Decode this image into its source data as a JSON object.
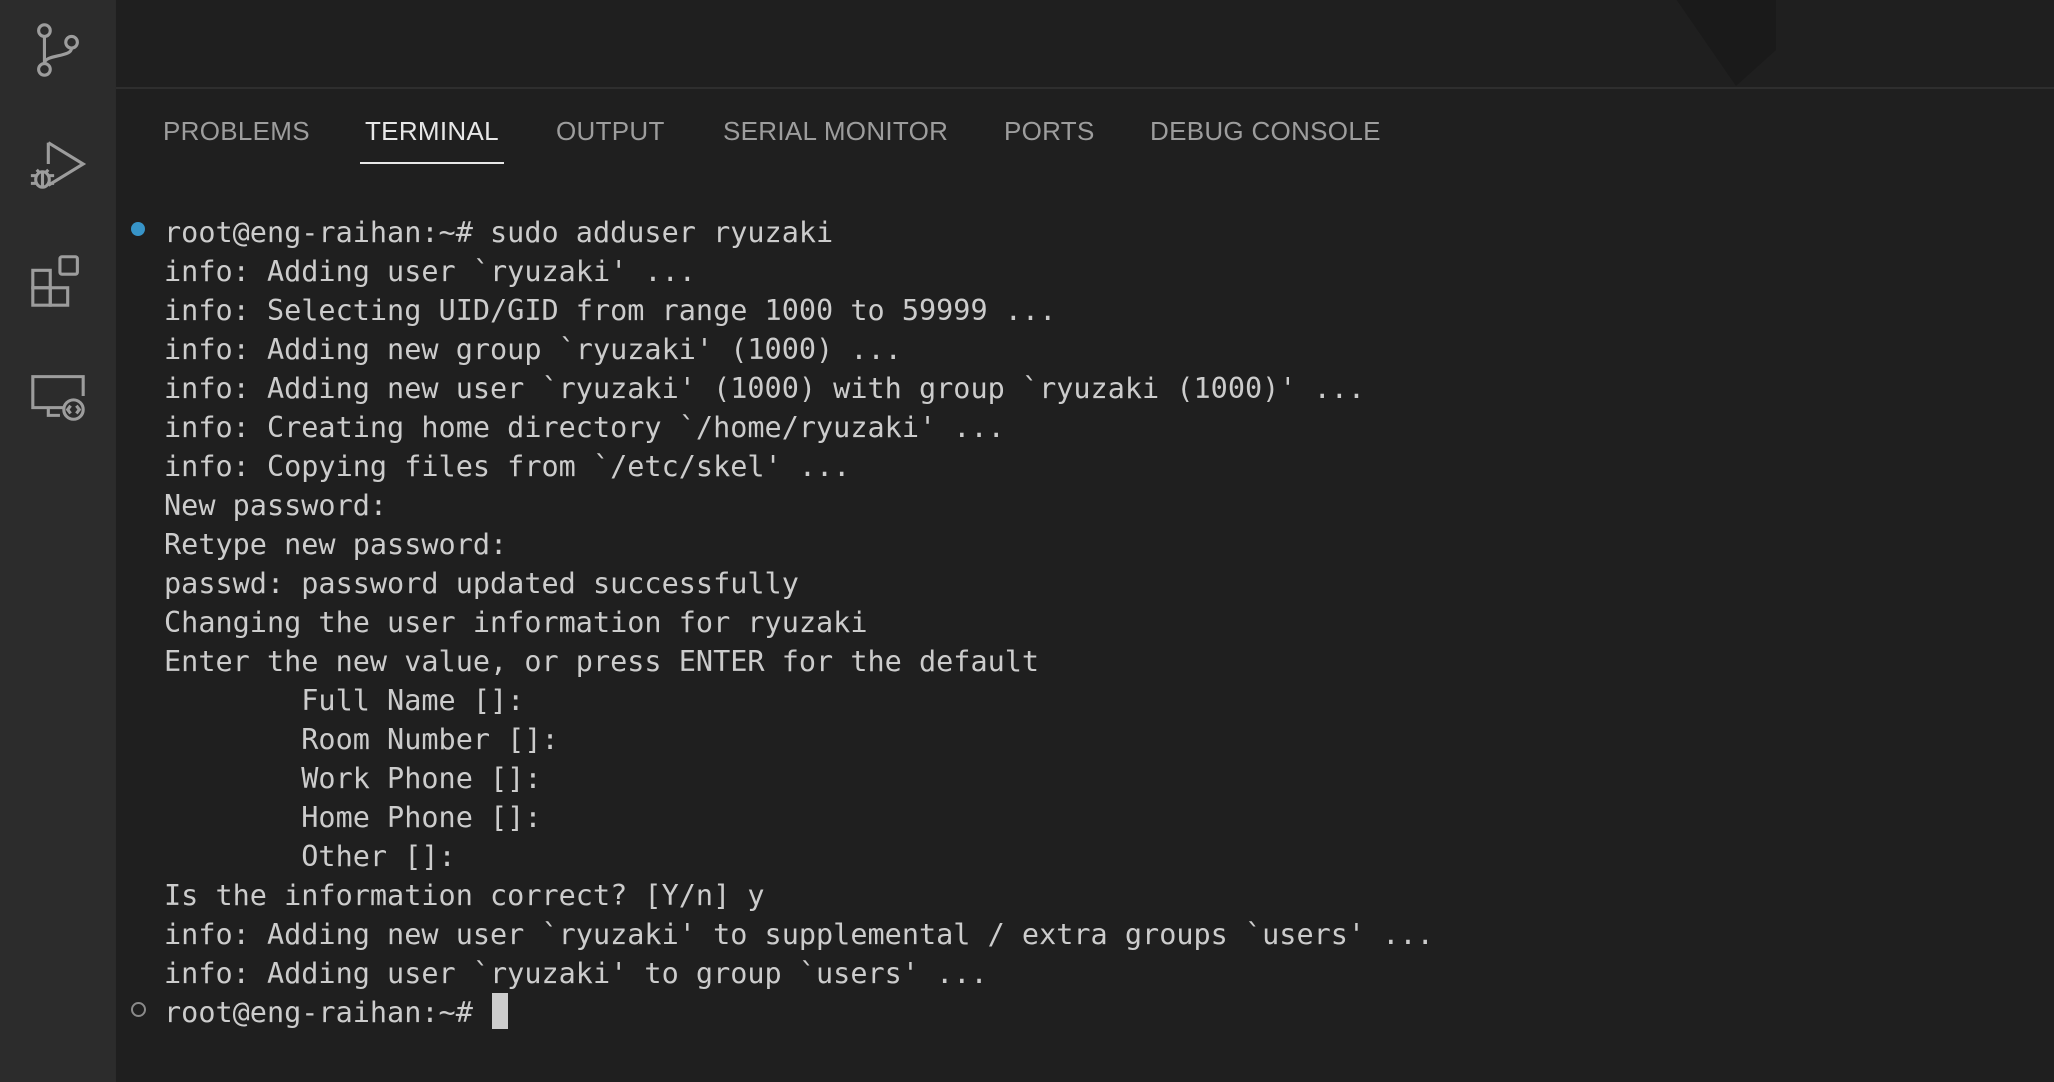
{
  "activity_bar": {
    "items": [
      {
        "name": "source-control",
        "icon": "source-control-icon"
      },
      {
        "name": "run-and-debug",
        "icon": "run-debug-icon"
      },
      {
        "name": "extensions",
        "icon": "extensions-icon"
      },
      {
        "name": "remote-explorer",
        "icon": "remote-explorer-icon"
      }
    ],
    "icon_color": "#9d9d9d"
  },
  "panel": {
    "tabs": [
      {
        "label": "PROBLEMS",
        "active": false
      },
      {
        "label": "TERMINAL",
        "active": true
      },
      {
        "label": "OUTPUT",
        "active": false
      },
      {
        "label": "SERIAL MONITOR",
        "active": false
      },
      {
        "label": "PORTS",
        "active": false
      },
      {
        "label": "DEBUG CONSOLE",
        "active": false
      }
    ]
  },
  "terminal": {
    "lines": [
      "root@eng-raihan:~# sudo adduser ryuzaki",
      "info: Adding user `ryuzaki' ...",
      "info: Selecting UID/GID from range 1000 to 59999 ...",
      "info: Adding new group `ryuzaki' (1000) ...",
      "info: Adding new user `ryuzaki' (1000) with group `ryuzaki (1000)' ...",
      "info: Creating home directory `/home/ryuzaki' ...",
      "info: Copying files from `/etc/skel' ...",
      "New password: ",
      "Retype new password: ",
      "passwd: password updated successfully",
      "Changing the user information for ryuzaki",
      "Enter the new value, or press ENTER for the default",
      "        Full Name []: ",
      "        Room Number []: ",
      "        Work Phone []: ",
      "        Home Phone []: ",
      "        Other []: ",
      "Is the information correct? [Y/n] y",
      "info: Adding new user `ryuzaki' to supplemental / extra groups `users' ...",
      "info: Adding user `ryuzaki' to group `users' ..."
    ],
    "prompt": "root@eng-raihan:~# ",
    "text_color": "#cccccc",
    "success_decoration_color": "#3794c8"
  }
}
